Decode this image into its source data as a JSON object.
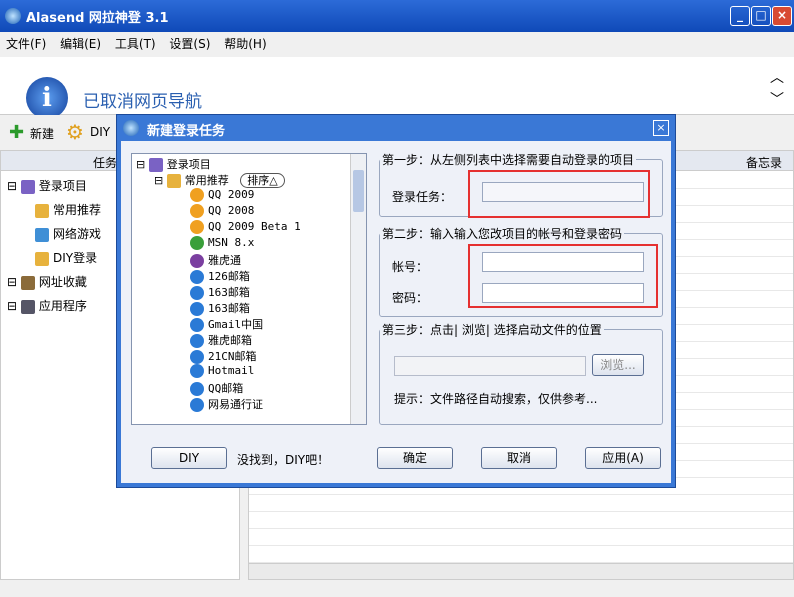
{
  "window": {
    "title": "Alasend 网拉神登 3.1"
  },
  "menu": [
    "文件(F)",
    "编辑(E)",
    "工具(T)",
    "设置(S)",
    "帮助(H)"
  ],
  "message": "已取消网页导航",
  "toolbar": {
    "new": "新建",
    "diy": "DIY"
  },
  "main": {
    "col_task": "任务",
    "col_memo": "备忘录",
    "tree": [
      {
        "label": "登录项目",
        "depth": 0
      },
      {
        "label": "常用推荐",
        "depth": 1
      },
      {
        "label": "网络游戏",
        "depth": 1
      },
      {
        "label": "DIY登录",
        "depth": 1
      },
      {
        "label": "网址收藏",
        "depth": 0
      },
      {
        "label": "应用程序",
        "depth": 0
      }
    ]
  },
  "dialog": {
    "title": "新建登录任务",
    "list": {
      "root": "登录项目",
      "group": "常用推荐",
      "sort": "排序",
      "items": [
        "QQ 2009",
        "QQ 2008",
        "QQ 2009 Beta 1",
        "MSN 8.x",
        "雅虎通",
        "126邮箱",
        "163邮箱",
        "163邮箱",
        "Gmail中国",
        "雅虎邮箱",
        "21CN邮箱",
        "Hotmail",
        "QQ邮箱",
        "网易通行证"
      ]
    },
    "step1": {
      "legend": "第一步：从左侧列表中选择需要自动登录的项目",
      "label": "登录任务：",
      "value": ""
    },
    "step2": {
      "legend": "第二步：输入输入您改项目的帐号和登录密码",
      "account": "帐号：",
      "password": "密码："
    },
    "step3": {
      "legend": "第三步：点击| 浏览| 选择启动文件的位置",
      "browse": "浏览...",
      "hint": "提示：文件路径自动搜索，仅供参考..."
    },
    "diy": "DIY",
    "diy_hint": "没找到，DIY吧！",
    "ok": "确定",
    "cancel": "取消",
    "apply": "应用(A)"
  }
}
